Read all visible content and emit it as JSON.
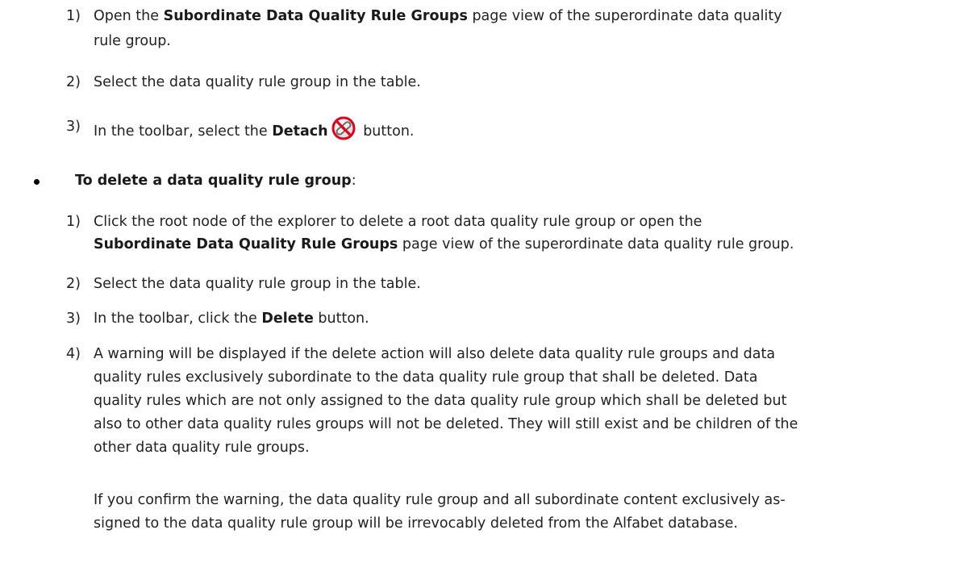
{
  "section1": {
    "steps": [
      {
        "num": "1)",
        "pre": "Open the ",
        "bold": "Subordinate Data Quality Rule Groups",
        "post": " page view of the superordinate data quality",
        "line2": "rule group."
      },
      {
        "num": "2)",
        "text": "Select the data quality rule group in the table."
      },
      {
        "num": "3)",
        "pre": "In the toolbar, select the ",
        "bold": "Detach",
        "post": " button.",
        "icon": "detach-icon"
      }
    ]
  },
  "section2": {
    "title_bold": "To delete a data quality rule group",
    "title_suffix": ":",
    "steps": [
      {
        "num": "1)",
        "line1": "Click the root node of the explorer to delete a root data quality rule group or open the",
        "line2_bold": "Subordinate Data Quality Rule Groups",
        "line2_post": " page view of the superordinate data quality rule group."
      },
      {
        "num": "2)",
        "text": "Select the data quality rule group in the table."
      },
      {
        "num": "3)",
        "pre": "In the toolbar, click the ",
        "bold": "Delete",
        "post": " button."
      },
      {
        "num": "4)",
        "lines": [
          "A warning will be displayed if the delete action will also delete data quality rule groups and data",
          "quality rules exclusively subordinate to the data quality rule group that shall be deleted. Data",
          "quality rules which are not only assigned to the data quality rule group which shall be deleted but",
          "also to other data quality rules groups will not be deleted. They will still exist and be children of the",
          "other data quality rule groups."
        ]
      }
    ],
    "confirm_paragraph": [
      "If you confirm the warning, the data quality rule group and all subordinate content exclusively as-",
      "signed to the data quality rule group will be irrevocably deleted from the Alfabet database."
    ]
  }
}
